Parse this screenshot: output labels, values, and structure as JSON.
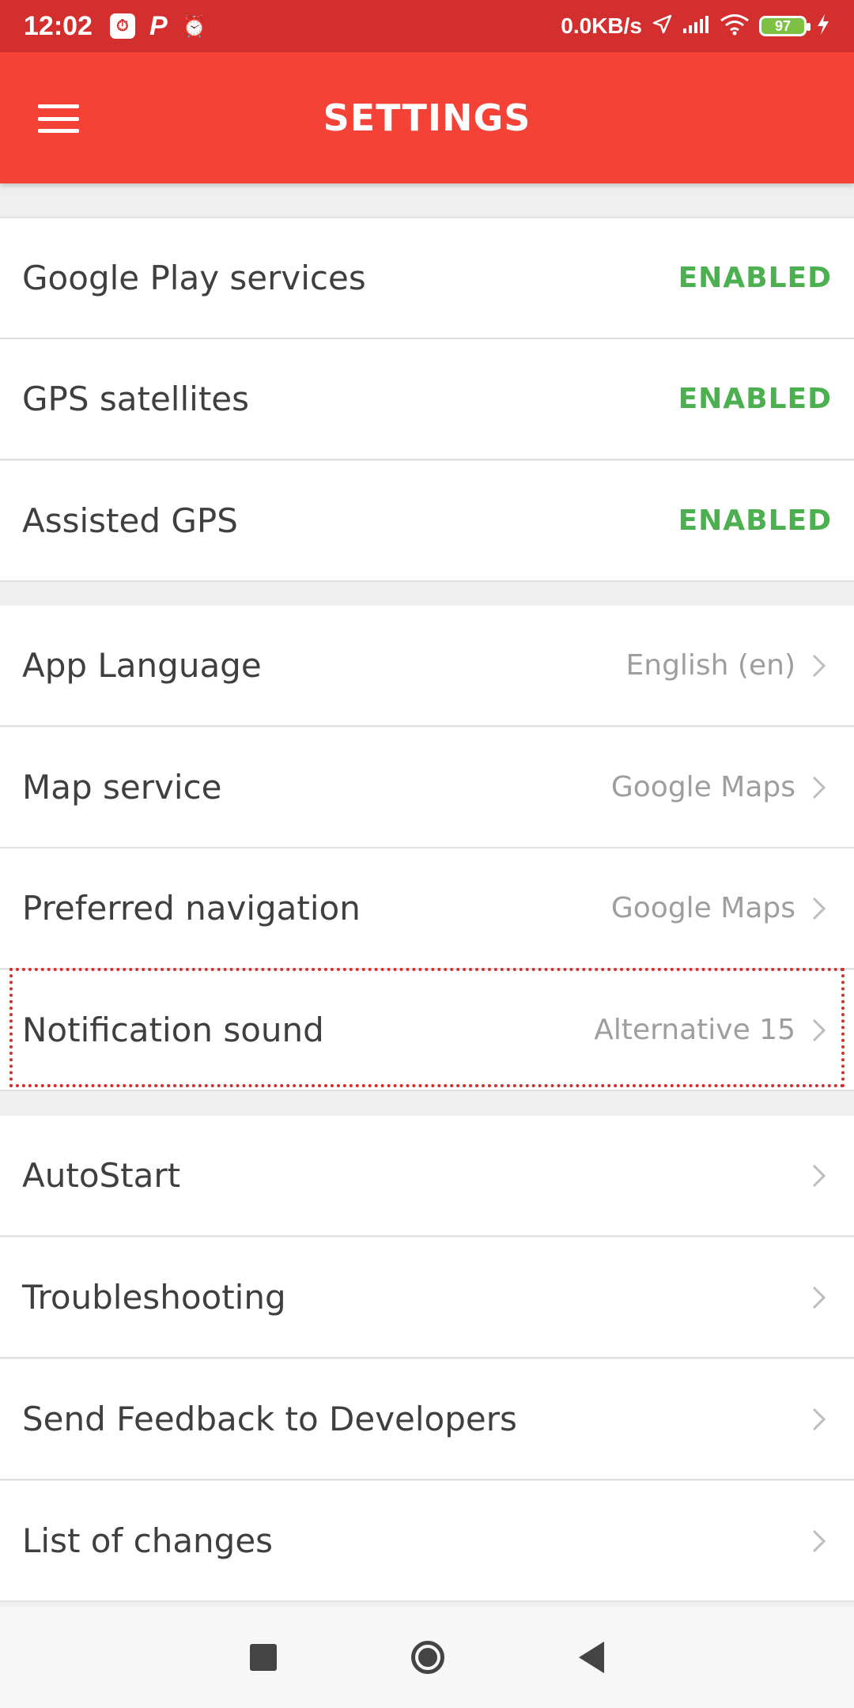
{
  "status_bar": {
    "time": "12:02",
    "p_label": "P",
    "network_rate": "0.0KB/s",
    "battery": "97",
    "icons": [
      "stopwatch-app-icon",
      "parking-icon",
      "alarm-icon",
      "location-arrow-icon",
      "signal-icon",
      "wifi-icon",
      "battery-icon",
      "charging-bolt-icon"
    ]
  },
  "app_bar": {
    "title": "SETTINGS",
    "menu_icon": "hamburger-menu-icon"
  },
  "colors": {
    "status_bar": "#d32f2f",
    "app_bar": "#f44336",
    "enabled": "#4caf50",
    "value": "#9e9e9e",
    "highlight": "#d32f2f"
  },
  "rows": [
    {
      "label": "Google Play services",
      "status": "ENABLED"
    },
    {
      "label": "GPS satellites",
      "status": "ENABLED"
    },
    {
      "label": "Assisted GPS",
      "status": "ENABLED"
    },
    {
      "label": "App Language",
      "value": "English (en)"
    },
    {
      "label": "Map service",
      "value": "Google Maps"
    },
    {
      "label": "Preferred navigation",
      "value": "Google Maps"
    },
    {
      "label": "Notification sound",
      "value": "Alternative 15"
    },
    {
      "label": "AutoStart",
      "value": ""
    },
    {
      "label": "Troubleshooting",
      "value": ""
    },
    {
      "label": "Send Feedback to Developers",
      "value": ""
    },
    {
      "label": "List of changes",
      "value": ""
    }
  ],
  "nav_bar": {
    "icons": [
      "recents-square-icon",
      "home-circle-icon",
      "back-triangle-icon"
    ]
  }
}
